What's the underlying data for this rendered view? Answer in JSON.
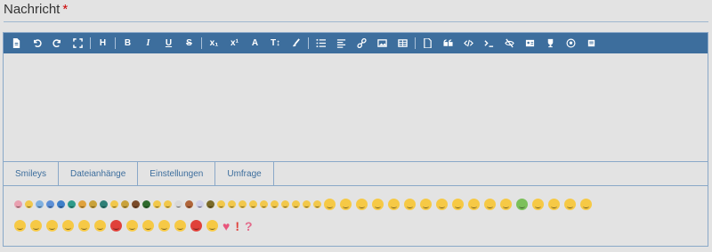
{
  "field": {
    "label": "Nachricht",
    "required_mark": "*"
  },
  "toolbar": {
    "heading_label": "H",
    "bold_label": "B",
    "italic_label": "I",
    "underline_label": "U",
    "strike_label": "S",
    "subscript_label": "x₁",
    "superscript_label": "x¹",
    "font_label": "A",
    "fontsize_label": "T↕"
  },
  "tabs": [
    {
      "label": "Smileys",
      "active": true
    },
    {
      "label": "Dateianhänge",
      "active": false
    },
    {
      "label": "Einstellungen",
      "active": false
    },
    {
      "label": "Umfrage",
      "active": false
    }
  ],
  "colors": {
    "toolbar_bg": "#3d6e9d",
    "border": "#8aa8c8",
    "tab_text": "#3d6e9d",
    "required": "#cc0000",
    "smiley_yellow": "#f6c945"
  },
  "smileys": {
    "row1_small": [
      "#e9a0b0",
      "#f2c84b",
      "#7fb0e0",
      "#5c8fd6",
      "#3f7fc9",
      "#2e9a8a",
      "#e0a23c",
      "#c9a23a",
      "#2e7f77",
      "#f2c84b",
      "#c9a23a",
      "#7a4b2a",
      "#2e6b2e",
      "#f2c84b",
      "#f2c84b",
      "#d9d9d9",
      "#b0653a",
      "#d0d0e8",
      "#7a6a2a",
      "#f2c84b",
      "#f2c84b",
      "#f2c84b",
      "#f2c84b",
      "#f2c84b",
      "#f2c84b",
      "#f2c84b",
      "#f2c84b",
      "#f2c84b",
      "#f2c84b"
    ],
    "row1_big": [
      "#f6c945",
      "#f6c945",
      "#f6c945",
      "#f6c945",
      "#f6c945",
      "#f6c945",
      "#f6c945",
      "#f6c945",
      "#f6c945",
      "#f6c945",
      "#f6c945",
      "#f6c945",
      "#7cc05a",
      "#f6c945",
      "#f6c945",
      "#f6c945",
      "#f6c945"
    ],
    "row2_big": [
      "#f6c945",
      "#f6c945",
      "#f6c945",
      "#f6c945",
      "#f6c945",
      "#f6c945",
      "#e0413a",
      "#f6c945",
      "#f6c945",
      "#f6c945",
      "#f6c945",
      "#e0413a",
      "#f6c945"
    ]
  }
}
